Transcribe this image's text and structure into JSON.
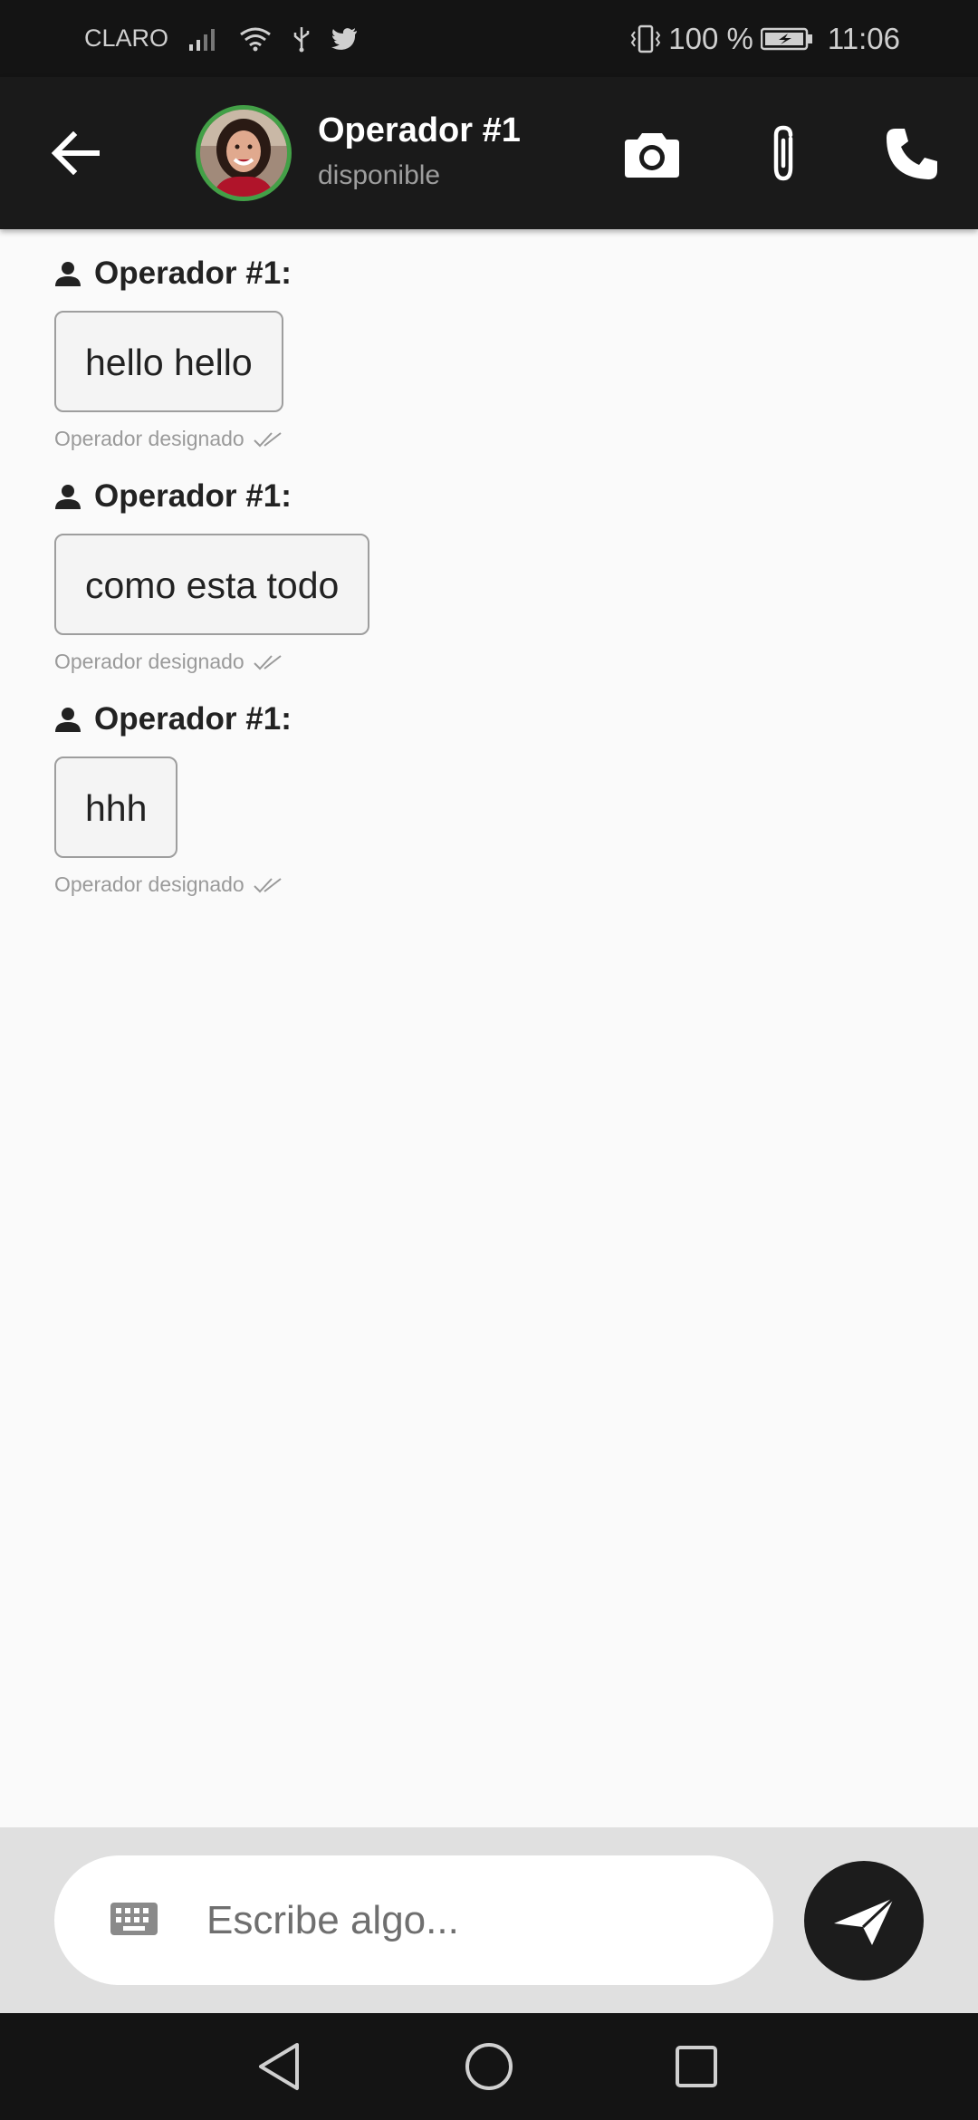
{
  "status_bar": {
    "carrier": "CLARO",
    "battery": "100 %",
    "time": "11:06",
    "icons": [
      "signal-icon",
      "wifi-icon",
      "usb-icon",
      "twitter-icon",
      "vibrate-icon",
      "battery-icon"
    ]
  },
  "header": {
    "contact_name": "Operador #1",
    "contact_status": "disponible",
    "accent_color": "#43a047",
    "actions": [
      "camera-icon",
      "attach-icon",
      "phone-icon"
    ]
  },
  "messages": [
    {
      "sender": "Operador #1:",
      "text": "hello hello",
      "status": "Operador designado"
    },
    {
      "sender": "Operador #1:",
      "text": "como esta todo",
      "status": "Operador designado"
    },
    {
      "sender": "Operador #1:",
      "text": "hhh",
      "status": "Operador designado"
    }
  ],
  "composer": {
    "placeholder": "Escribe algo...",
    "value": ""
  },
  "nav_bar": {
    "buttons": [
      "back-triangle-icon",
      "home-circle-icon",
      "recents-square-icon"
    ]
  }
}
